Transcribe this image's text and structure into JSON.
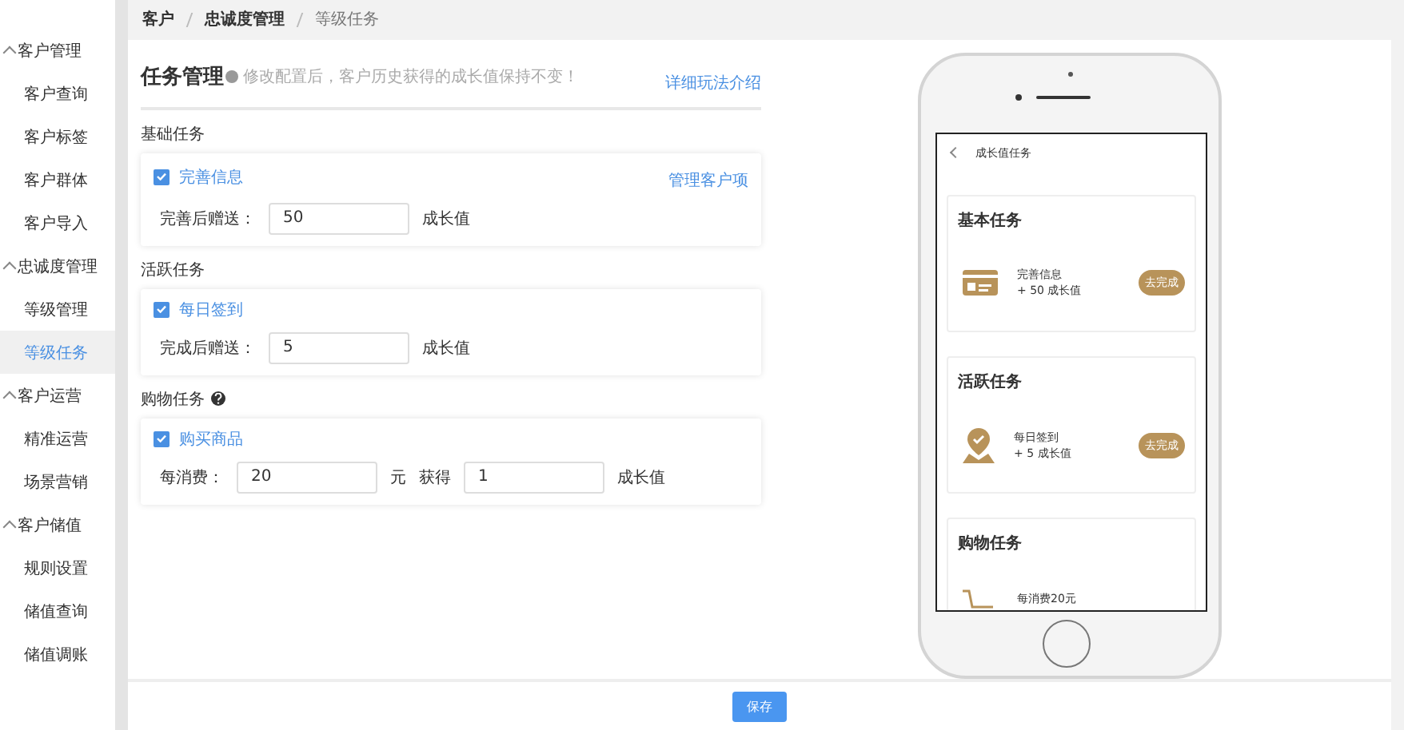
{
  "sidebar": {
    "groups": [
      {
        "label": "客户管理",
        "expanded": true,
        "items": [
          {
            "label": "客户查询",
            "selected": false
          },
          {
            "label": "客户标签",
            "selected": false
          },
          {
            "label": "客户群体",
            "selected": false
          },
          {
            "label": "客户导入",
            "selected": false
          }
        ]
      },
      {
        "label": "忠诚度管理",
        "expanded": true,
        "items": [
          {
            "label": "等级管理",
            "selected": false
          },
          {
            "label": "等级任务",
            "selected": true
          }
        ]
      },
      {
        "label": "客户运营",
        "expanded": true,
        "items": [
          {
            "label": "精准运营",
            "selected": false
          },
          {
            "label": "场景营销",
            "selected": false
          }
        ]
      },
      {
        "label": "客户储值",
        "expanded": true,
        "items": [
          {
            "label": "规则设置",
            "selected": false
          },
          {
            "label": "储值查询",
            "selected": false
          },
          {
            "label": "储值调账",
            "selected": false
          }
        ]
      }
    ]
  },
  "breadcrumb": [
    "客户",
    "忠诚度管理",
    "等级任务"
  ],
  "panel": {
    "title": "任务管理",
    "hint": "修改配置后，客户历史获得的成长值保持不变！",
    "help_link": "详细玩法介绍"
  },
  "task_groups": [
    {
      "label": "基础任务",
      "has_help": false,
      "link": "管理客户项",
      "task": {
        "label": "完善信息",
        "checked": true,
        "fields": [
          {
            "kind": "label",
            "text": "完善后赠送："
          },
          {
            "kind": "input",
            "value": "50"
          },
          {
            "kind": "unit",
            "text": "成长值"
          }
        ]
      }
    },
    {
      "label": "活跃任务",
      "has_help": false,
      "task": {
        "label": "每日签到",
        "checked": true,
        "fields": [
          {
            "kind": "label",
            "text": "完成后赠送："
          },
          {
            "kind": "input",
            "value": "5"
          },
          {
            "kind": "unit",
            "text": "成长值"
          }
        ]
      }
    },
    {
      "label": "购物任务",
      "has_help": true,
      "task": {
        "label": "购买商品",
        "checked": true,
        "fields": [
          {
            "kind": "label",
            "text": "每消费："
          },
          {
            "kind": "input",
            "value": "20"
          },
          {
            "kind": "unit",
            "text": "元"
          },
          {
            "kind": "unit",
            "text": "获得"
          },
          {
            "kind": "input",
            "value": "1"
          },
          {
            "kind": "unit",
            "text": "成长值"
          }
        ]
      }
    }
  ],
  "phone": {
    "title": "成长值任务",
    "sections": [
      {
        "title": "基本任务",
        "kind": "card",
        "task": "完善信息",
        "reward": "+ 50 成长值",
        "action": "去完成"
      },
      {
        "title": "活跃任务",
        "kind": "pin",
        "task": "每日签到",
        "reward": "+ 5 成长值",
        "action": "去完成"
      },
      {
        "title": "购物任务",
        "kind": "cart",
        "task": "每消费20元"
      }
    ]
  },
  "save_button": "保存"
}
